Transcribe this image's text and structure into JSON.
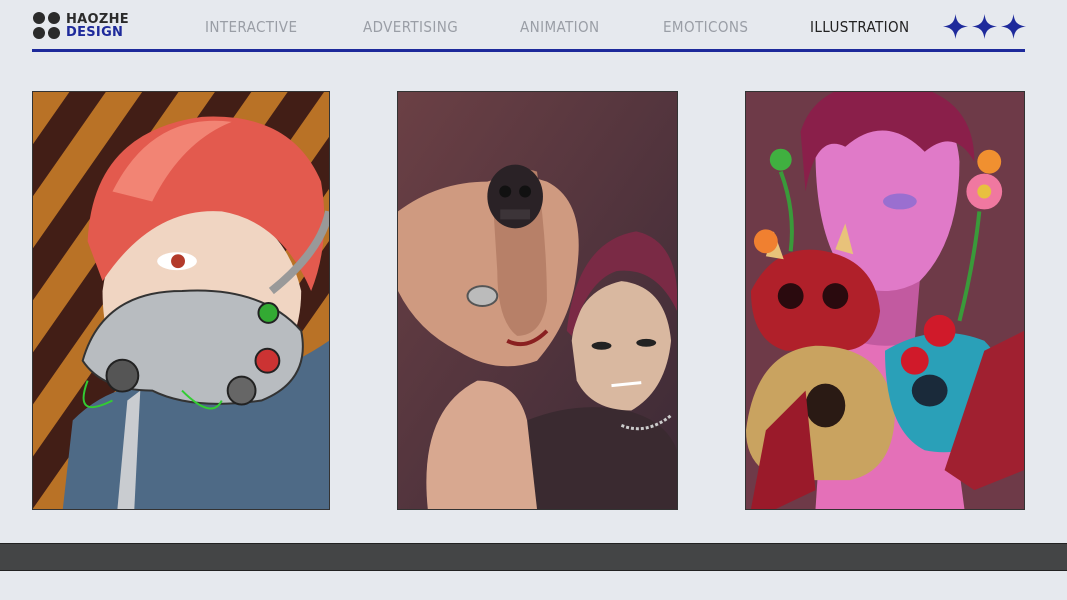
{
  "brand": {
    "line1": "HAOZHE",
    "line2": "DESIGN",
    "accent_color": "#1e2a9b"
  },
  "nav": {
    "items": [
      {
        "label": "INTERACTIVE"
      },
      {
        "label": "ADVERTISING"
      },
      {
        "label": "ANIMATION"
      },
      {
        "label": "EMOTICONS"
      },
      {
        "label": "ILLUSTRATION"
      }
    ],
    "active": "ILLUSTRATION"
  },
  "header_icons": [
    "four-point-star-icon",
    "four-point-star-icon",
    "four-point-star-icon"
  ],
  "gallery": {
    "artworks": [
      {
        "subject": "red-haired figure in mechanical gas mask"
      },
      {
        "subject": "skull ring hand over red-haired boy"
      },
      {
        "subject": "pink figure with skulls and flowers"
      }
    ]
  }
}
